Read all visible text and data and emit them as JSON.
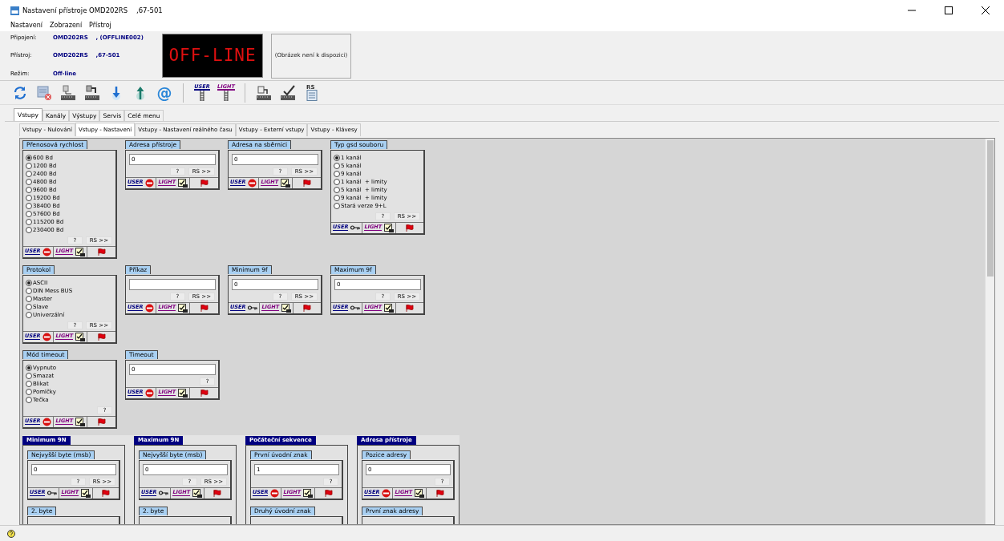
{
  "window": {
    "title": "Nastavení přístroje OMD202RS    ,67-501"
  },
  "menu": [
    "Nastavení",
    "Zobrazení",
    "Přístroj"
  ],
  "info": [
    {
      "label": "Připojení:",
      "value": "OMD202RS    , (OFFLINE002)"
    },
    {
      "label": "Přístroj:",
      "value": "OMD202RS    ,67-501"
    },
    {
      "label": "Režim:",
      "value": "Off-line"
    }
  ],
  "display": "OFF-LINE",
  "image_placeholder": "(Obrázek není k dispozici)",
  "toolbar": [
    [
      {
        "kind": "refresh"
      },
      {
        "kind": "delete"
      },
      {
        "kind": "upload"
      },
      {
        "kind": "download"
      },
      {
        "kind": "down"
      },
      {
        "kind": "up"
      },
      {
        "kind": "at",
        "label": "@"
      }
    ],
    [
      {
        "kind": "plan",
        "label": "USER",
        "color": "#000080"
      },
      {
        "kind": "plan",
        "label": "LIGHT",
        "color": "#800080"
      }
    ],
    [
      {
        "kind": "device"
      },
      {
        "kind": "check"
      },
      {
        "kind": "doc",
        "label": "RS"
      }
    ]
  ],
  "tabs": [
    {
      "label": "Vstupy",
      "selected": true
    },
    {
      "label": "Kanály",
      "selected": false
    },
    {
      "label": "Výstupy",
      "selected": false
    },
    {
      "label": "Servis",
      "selected": false
    },
    {
      "label": "Celé menu",
      "selected": false
    }
  ],
  "subtabs": [
    {
      "label": "Vstupy - Nulování",
      "selected": false
    },
    {
      "label": "Vstupy - Nastavení",
      "selected": true
    },
    {
      "label": "Vstupy - Nastavení reálného času",
      "selected": false
    },
    {
      "label": "Vstupy - Externí vstupy",
      "selected": false
    },
    {
      "label": "Vstupy - Klávesy",
      "selected": false
    }
  ],
  "panel_rows": [
    [
      {
        "title": "Přenosová rychlost",
        "kind": "radio",
        "options": [
          {
            "label": "600 Bd",
            "selected": true
          },
          {
            "label": "1200 Bd",
            "selected": false
          },
          {
            "label": "2400 Bd",
            "selected": false
          },
          {
            "label": "4800 Bd",
            "selected": false
          },
          {
            "label": "9600 Bd",
            "selected": false
          },
          {
            "label": "19200 Bd",
            "selected": false
          },
          {
            "label": "38400 Bd",
            "selected": false
          },
          {
            "label": "57600 Bd",
            "selected": false
          },
          {
            "label": "115200 Bd",
            "selected": false
          },
          {
            "label": "230400 Bd",
            "selected": false
          }
        ],
        "buttons": [
          "?",
          "RS >>"
        ],
        "footer": {
          "user": "USER",
          "kind": "stop",
          "light": "LIGHT"
        }
      },
      {
        "title": "Adresa přístroje",
        "kind": "field",
        "value": "0",
        "buttons": [
          "?",
          "RS >>"
        ],
        "footer": {
          "user": "USER",
          "kind": "stop",
          "light": "LIGHT"
        }
      },
      {
        "title": "Adresa na sběrnici",
        "kind": "field",
        "value": "0",
        "buttons": [
          "?",
          "RS >>"
        ],
        "footer": {
          "user": "USER",
          "kind": "stop",
          "light": "LIGHT"
        }
      },
      {
        "title": "Typ gsd souboru",
        "kind": "radio",
        "options": [
          {
            "label": "1 kanál",
            "selected": true
          },
          {
            "label": "5 kanál",
            "selected": false
          },
          {
            "label": "9 kanál",
            "selected": false
          },
          {
            "label": "1 kanál  + limity",
            "selected": false
          },
          {
            "label": "5 kanál  + limity",
            "selected": false
          },
          {
            "label": "9 kanál  + limity",
            "selected": false
          },
          {
            "label": "Stará verze 9+L",
            "selected": false
          }
        ],
        "buttons": [
          "?",
          "RS >>"
        ],
        "footer": {
          "user": "USER",
          "kind": "key",
          "light": "LIGHT"
        }
      }
    ],
    [
      {
        "title": "Protokol",
        "kind": "radio",
        "options": [
          {
            "label": "ASCII",
            "selected": true
          },
          {
            "label": "DIN Mess BUS",
            "selected": false
          },
          {
            "label": "Master",
            "selected": false
          },
          {
            "label": "Slave",
            "selected": false
          },
          {
            "label": "Univerzální",
            "selected": false
          }
        ],
        "buttons": [
          "?",
          "RS >>"
        ],
        "footer": {
          "user": "USER",
          "kind": "stop",
          "light": "LIGHT"
        }
      },
      {
        "title": "Příkaz",
        "kind": "field",
        "buttons": [
          "?",
          "RS >>"
        ],
        "footer": {
          "user": "USER",
          "kind": "stop",
          "light": "LIGHT"
        }
      },
      {
        "title": "Minimum 9f",
        "kind": "field",
        "value": "0",
        "buttons": [
          "?",
          "RS >>"
        ],
        "footer": {
          "user": "USER",
          "kind": "key",
          "light": "LIGHT"
        }
      },
      {
        "title": "Maximum 9f",
        "kind": "field",
        "value": "0",
        "buttons": [
          "?",
          "RS >>"
        ],
        "footer": {
          "user": "USER",
          "kind": "key",
          "light": "LIGHT"
        }
      }
    ],
    [
      {
        "title": "Mód timeout",
        "kind": "radio",
        "options": [
          {
            "label": "Vypnuto",
            "selected": true
          },
          {
            "label": "Smazat",
            "selected": false
          },
          {
            "label": "Blikat",
            "selected": false
          },
          {
            "label": "Pomlčky",
            "selected": false
          },
          {
            "label": "Tečka",
            "selected": false
          }
        ],
        "buttons": [
          "?"
        ],
        "footer": {
          "user": "USER",
          "kind": "stop",
          "light": "LIGHT"
        }
      },
      {
        "title": "Timeout",
        "kind": "field",
        "value": "0",
        "buttons": [
          "?"
        ],
        "footer": {
          "user": "USER",
          "kind": "stop",
          "light": "LIGHT"
        }
      }
    ]
  ],
  "groups": [
    {
      "title": "Minimum 9N",
      "panels": [
        {
          "title": "Nejvyšší byte (msb)",
          "kind": "field",
          "value": "0",
          "buttons": [
            "?",
            "RS >>"
          ],
          "footer": {
            "user": "USER",
            "kind": "key",
            "light": "LIGHT"
          }
        },
        {
          "title": "2. byte"
        }
      ]
    },
    {
      "title": "Maximum 9N",
      "panels": [
        {
          "title": "Nejvyšší byte (msb)",
          "kind": "field",
          "value": "0",
          "buttons": [
            "?",
            "RS >>"
          ],
          "footer": {
            "user": "USER",
            "kind": "key",
            "light": "LIGHT"
          }
        },
        {
          "title": "2. byte"
        }
      ]
    },
    {
      "title": "Počáteční sekvence",
      "panels": [
        {
          "title": "První úvodní znak",
          "kind": "field",
          "value": "1",
          "buttons": [
            "?"
          ],
          "footer": {
            "user": "USER",
            "kind": "stop",
            "light": "LIGHT"
          }
        },
        {
          "title": "Druhý úvodní znak"
        }
      ]
    },
    {
      "title": "Adresa přístroje",
      "panels": [
        {
          "title": "Pozice adresy",
          "kind": "field",
          "value": "0",
          "buttons": [
            "?"
          ],
          "footer": {
            "user": "USER",
            "kind": "stop",
            "light": "LIGHT"
          }
        },
        {
          "title": "První znak adresy"
        }
      ]
    }
  ]
}
